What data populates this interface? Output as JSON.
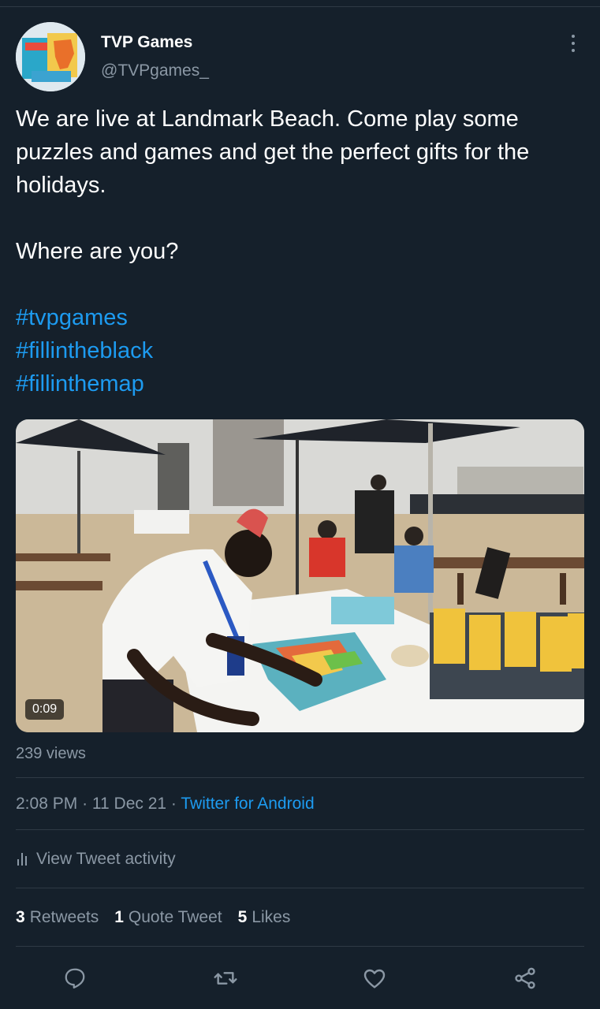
{
  "author": {
    "name": "TVP Games",
    "handle": "@TVPgames_"
  },
  "tweet": {
    "line1": "We are live at Landmark Beach. Come play some puzzles and games and get the perfect gifts for the holidays.",
    "line2": "Where are you?",
    "hashtags": [
      "#tvpgames",
      "#fillintheblack",
      "#fillinthemap"
    ]
  },
  "video": {
    "duration": "0:09"
  },
  "views": "239 views",
  "meta": {
    "time": "2:08 PM",
    "sep1": "·",
    "date": "11 Dec 21",
    "sep2": "·",
    "source": "Twitter for Android"
  },
  "activity_label": "View Tweet activity",
  "stats": {
    "retweets_count": "3",
    "retweets_label": "Retweets",
    "quotes_count": "1",
    "quotes_label": "Quote Tweet",
    "likes_count": "5",
    "likes_label": "Likes"
  },
  "icons": {
    "reply": "reply-icon",
    "retweet": "retweet-icon",
    "like": "heart-icon",
    "share": "share-icon"
  },
  "colors": {
    "background": "#15202b",
    "accent": "#1d9bf0",
    "secondary_text": "#8b98a5",
    "divider": "#2f3a45"
  }
}
